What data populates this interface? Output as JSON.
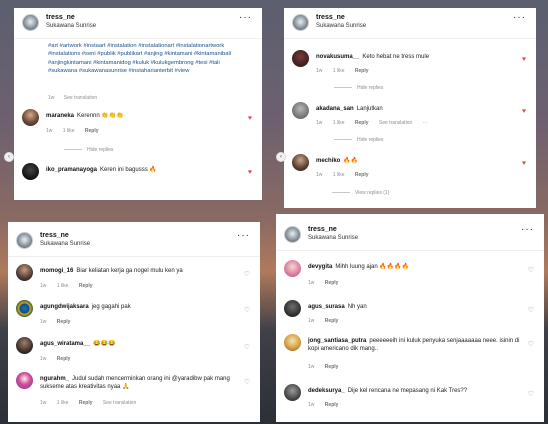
{
  "post": {
    "username": "tress_ne",
    "location": "Sukawana Sunrise"
  },
  "caption": {
    "hashtags": "#art #artwork #instaart #instalation #instalationart #instalationartwork #instalations #seni #publik #publikart #anjing #kintamani #kintamanibali #anjingkintamani #kintamanidog #kuluk #kulukgembrong #tesi #tali #sukawana #sukawanasunrise #instaharianterbit #view",
    "time": "1w",
    "see_translation": "See translation"
  },
  "panel1": {
    "comments": [
      {
        "user": "maraneka",
        "text": "Kerennn 👏👏👏",
        "time": "1w",
        "likes": "1 like",
        "reply": "Reply",
        "liked": true,
        "hide": "Hide replies"
      },
      {
        "user": "iko_pramanayoga",
        "text": "Keren ini bagusss 🔥",
        "time": "",
        "likes": "",
        "reply": "",
        "liked": true
      }
    ]
  },
  "panel2": {
    "comments": [
      {
        "user": "novakusuma__",
        "text": "Keto hebat ne tress mule",
        "time": "1w",
        "likes": "1 like",
        "reply": "Reply",
        "liked": true,
        "hide": "Hide replies"
      },
      {
        "user": "akadana_san",
        "text": "Lanjutkan",
        "time": "1w",
        "likes": "1 like",
        "reply": "Reply",
        "see_translation": "See translation",
        "more": "···",
        "liked": true,
        "hide": "Hide replies"
      },
      {
        "user": "mechiko",
        "text": "🔥🔥",
        "time": "1w",
        "likes": "1 like",
        "reply": "Reply",
        "liked": true,
        "view": "View replies (1)"
      }
    ]
  },
  "panel3": {
    "comments": [
      {
        "user": "momogi_16",
        "text": "Biar keliatan kerja ga nogel mulu ken ya",
        "time": "1w",
        "likes": "1 like",
        "reply": "Reply"
      },
      {
        "user": "agungdwijaksara",
        "text": "jeg gagahi pak",
        "time": "1w",
        "reply": "Reply"
      },
      {
        "user": "agus_wiratama__",
        "text": "😂😂😂",
        "time": "1w",
        "reply": "Reply"
      },
      {
        "user": "ngurahm_",
        "text": "Judul sudah mencerminkan orang ini @yaradibw pak mang sukseme atas kreativitas nyaa 🙏",
        "time": "1w",
        "likes": "1 like",
        "reply": "Reply",
        "see_translation": "See translation"
      }
    ]
  },
  "panel4": {
    "comments": [
      {
        "user": "devygita",
        "text": "Mihh luung ajan 🔥🔥🔥🔥",
        "time": "1w",
        "reply": "Reply"
      },
      {
        "user": "agus_surasa",
        "text": "Nh yan",
        "time": "1w",
        "reply": "Reply"
      },
      {
        "user": "jong_santiasa_putra",
        "text": "peeeeeeih ini kuluk penyuka senjaaaaaaa neee. isinin di kopi americano dik mang..",
        "time": "1w",
        "reply": "Reply"
      },
      {
        "user": "dedeksurya_",
        "text": "Dije kel rencana ne mepasang ni Kak Tres??",
        "time": "1w",
        "reply": "Reply"
      }
    ]
  }
}
